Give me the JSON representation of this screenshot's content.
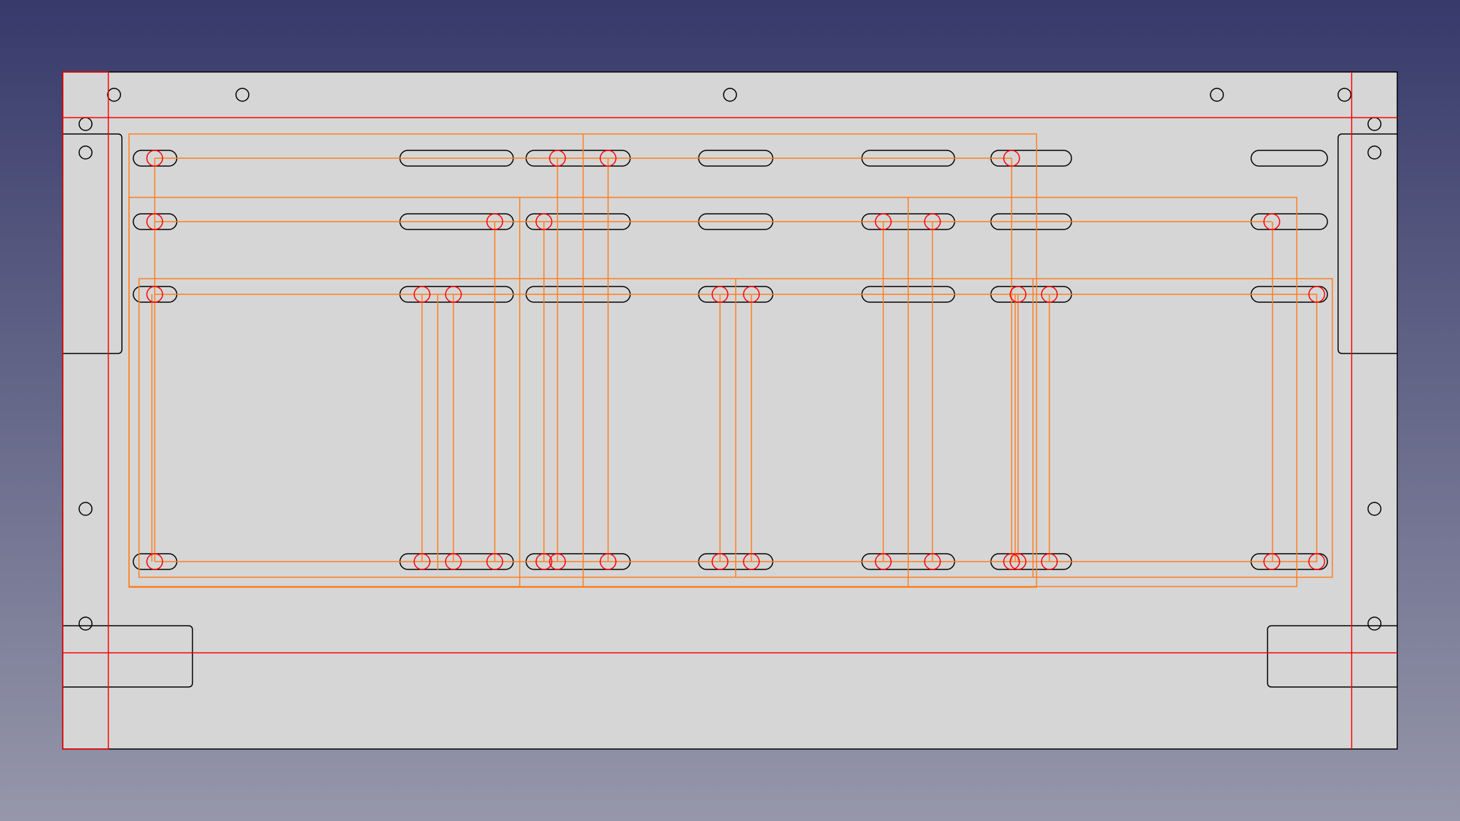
{
  "view": {
    "background_top": "#373a6a",
    "background_bottom": "#9697aa",
    "sheet_fill": "#d6d6d6",
    "outline_color": "#000000",
    "constraint_color": "#ff0000",
    "path_color": "#ff7f1f"
  },
  "elements": {
    "sheet": "panel-outline",
    "features": [
      "mounting-holes",
      "slots",
      "corner-notches",
      "reference-lines",
      "toolpaths",
      "toolpath-holes"
    ]
  }
}
